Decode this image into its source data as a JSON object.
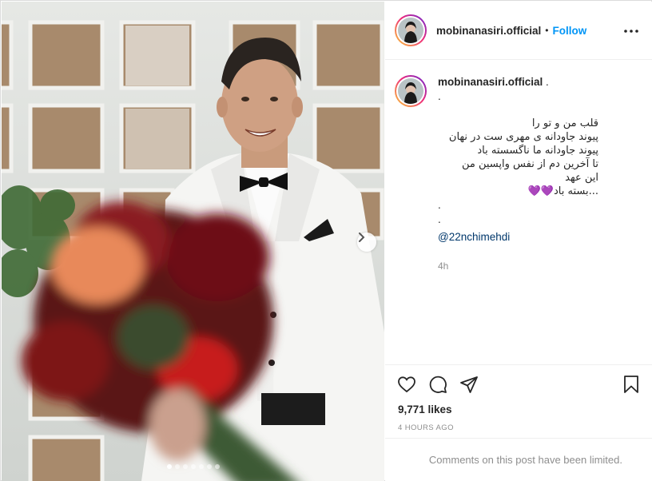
{
  "post": {
    "username": "mobinanasiri.official",
    "separator": "•",
    "follow_label": "Follow",
    "more_icon": "more-horizontal-icon"
  },
  "caption": {
    "username": "mobinanasiri.official",
    "after_name": ".",
    "line_dot": ".",
    "lines": [
      "قلب من و تو را",
      "پیوند جاودانه ی مهری ست در نهان",
      "پیوند جاودانه ما ناگسسته باد",
      "تا آخرین دم از نفس واپسین من",
      "این عهد",
      "...بسته باد",
      ".",
      "."
    ],
    "hearts": "💜💜",
    "mention": "@22nchimehdi",
    "time": "4h"
  },
  "actions": {
    "like_icon": "heart-icon",
    "comment_icon": "comment-icon",
    "share_icon": "share-icon",
    "save_icon": "bookmark-icon",
    "likes": "9,771 likes",
    "time_ago": "4 HOURS AGO"
  },
  "comments": {
    "limited_text": "Comments on this post have been limited."
  },
  "carousel": {
    "slide_count": 7,
    "active_index": 0
  },
  "colors": {
    "follow": "#0095f6",
    "mention": "#00376b",
    "muted": "#8e8e8e"
  }
}
